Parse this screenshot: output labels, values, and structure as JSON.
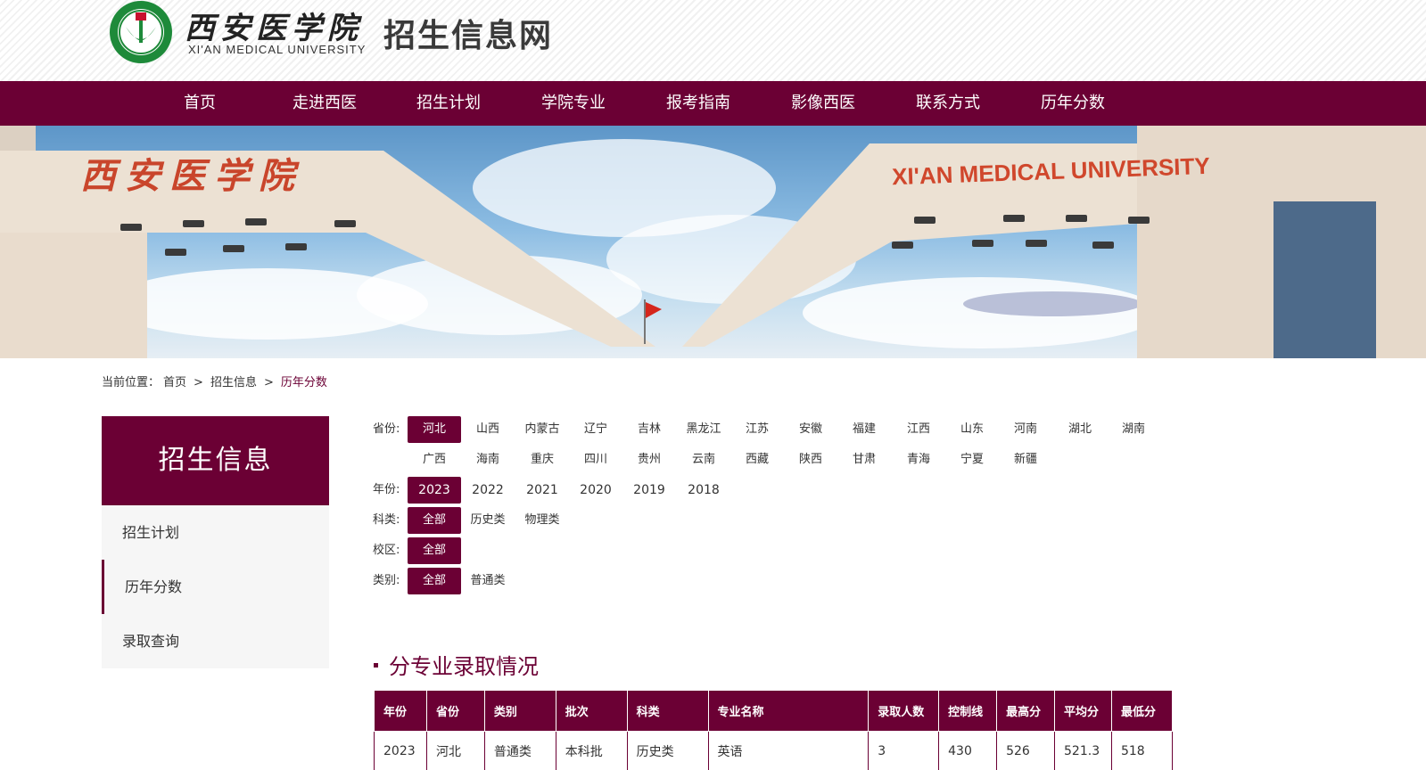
{
  "header": {
    "logo_cn": "西安医学院",
    "logo_en": "XI'AN MEDICAL UNIVERSITY",
    "site_title": "招生信息网"
  },
  "nav": [
    "首页",
    "走进西医",
    "招生计划",
    "学院专业",
    "报考指南",
    "影像西医",
    "联系方式",
    "历年分数"
  ],
  "banner": {
    "sign_cn": "西安医学院",
    "sign_en": "XI'AN MEDICAL UNIVERSITY"
  },
  "breadcrumb": {
    "prefix": "当前位置：",
    "items": [
      "首页",
      ">",
      "招生信息",
      ">",
      "历年分数"
    ]
  },
  "sidebar": {
    "title": "招生信息",
    "items": [
      "招生计划",
      "历年分数",
      "录取查询"
    ],
    "active_index": 1
  },
  "filters": {
    "province_label": "省份:",
    "provinces_row1": [
      "河北",
      "山西",
      "内蒙古",
      "辽宁",
      "吉林",
      "黑龙江",
      "江苏",
      "安徽",
      "福建",
      "江西",
      "山东",
      "河南",
      "湖北",
      "湖南"
    ],
    "provinces_row2": [
      "广西",
      "海南",
      "重庆",
      "四川",
      "贵州",
      "云南",
      "西藏",
      "陕西",
      "甘肃",
      "青海",
      "宁夏",
      "新疆"
    ],
    "selected_province": "河北",
    "year_label": "年份:",
    "years": [
      "2023",
      "2022",
      "2021",
      "2020",
      "2019",
      "2018"
    ],
    "selected_year": "2023",
    "subject_label": "科类:",
    "subjects": [
      "全部",
      "历史类",
      "物理类"
    ],
    "campus_label": "校区:",
    "campuses": [
      "全部"
    ],
    "category_label": "类别:",
    "categories": [
      "全部",
      "普通类"
    ]
  },
  "section": {
    "title": "分专业录取情况"
  },
  "table": {
    "headers": [
      "年份",
      "省份",
      "类别",
      "批次",
      "科类",
      "专业名称",
      "录取人数",
      "控制线",
      "最高分",
      "平均分",
      "最低分"
    ],
    "rows": [
      [
        "2023",
        "河北",
        "普通类",
        "本科批",
        "历史类",
        "英语",
        "3",
        "430",
        "526",
        "521.3",
        "518"
      ]
    ]
  },
  "colors": {
    "brand": "#6b0034",
    "sidebar_bg": "#f6f6f6",
    "logo_green": "#1e8a3a"
  }
}
